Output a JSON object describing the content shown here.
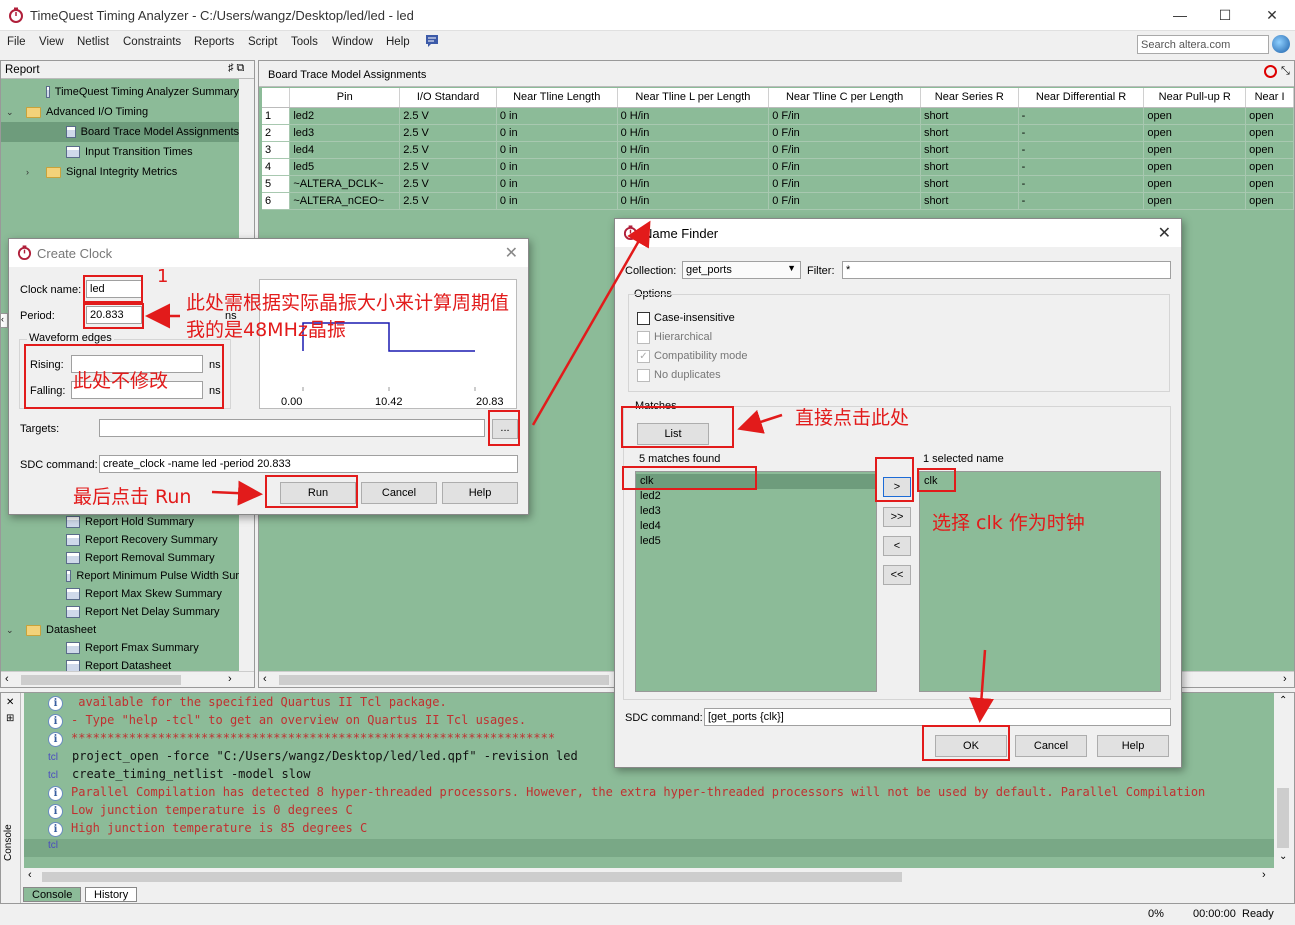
{
  "window": {
    "title": "TimeQuest Timing Analyzer - C:/Users/wangz/Desktop/led/led - led",
    "minimize": "—",
    "maximize": "☐",
    "close": "✕"
  },
  "menu": [
    "File",
    "View",
    "Netlist",
    "Constraints",
    "Reports",
    "Script",
    "Tools",
    "Window",
    "Help"
  ],
  "search": {
    "placeholder": "Search altera.com"
  },
  "report": {
    "label": "Report",
    "pin": "♯ ⧉",
    "items_top": [
      {
        "label": "TimeQuest Timing Analyzer Summary",
        "icon": "table-icon",
        "indent": 45,
        "arrow": ""
      },
      {
        "label": "Advanced I/O Timing",
        "icon": "folder-icon",
        "indent": 25,
        "arrow": "⌄"
      },
      {
        "label": "Board Trace Model Assignments",
        "icon": "table-icon",
        "indent": 65,
        "arrow": "",
        "selected": true
      },
      {
        "label": "Input Transition Times",
        "icon": "table-icon",
        "indent": 65,
        "arrow": ""
      },
      {
        "label": "Signal Integrity Metrics",
        "icon": "folder-icon",
        "indent": 45,
        "arrow": "›"
      }
    ],
    "items_bottom": [
      {
        "label": "Report Hold Summary",
        "icon": "report-icon",
        "indent": 65,
        "arrow": ""
      },
      {
        "label": "Report Recovery Summary",
        "icon": "report-icon",
        "indent": 65,
        "arrow": ""
      },
      {
        "label": "Report Removal Summary",
        "icon": "report-icon",
        "indent": 65,
        "arrow": ""
      },
      {
        "label": "Report Minimum Pulse Width Sur",
        "icon": "report-icon",
        "indent": 65,
        "arrow": ""
      },
      {
        "label": "Report Max Skew Summary",
        "icon": "report-icon",
        "indent": 65,
        "arrow": ""
      },
      {
        "label": "Report Net Delay Summary",
        "icon": "report-icon",
        "indent": 65,
        "arrow": ""
      },
      {
        "label": "Datasheet",
        "icon": "folder-icon",
        "indent": 25,
        "arrow": "⌄"
      },
      {
        "label": "Report Fmax Summary",
        "icon": "report-icon",
        "indent": 65,
        "arrow": ""
      },
      {
        "label": "Report Datasheet",
        "icon": "report-icon",
        "indent": 65,
        "arrow": ""
      }
    ]
  },
  "board": {
    "title": "Board Trace Model Assignments",
    "columns": [
      "",
      "Pin",
      "I/O Standard",
      "Near Tline Length",
      "Near Tline L per Length",
      "Near Tline C per Length",
      "Near Series R",
      "Near Differential R",
      "Near Pull-up R",
      "Near I"
    ],
    "rows": [
      [
        "1",
        "led2",
        "2.5 V",
        "0 in",
        "0 H/in",
        "0 F/in",
        "short",
        "-",
        "open",
        "open"
      ],
      [
        "2",
        "led3",
        "2.5 V",
        "0 in",
        "0 H/in",
        "0 F/in",
        "short",
        "-",
        "open",
        "open"
      ],
      [
        "3",
        "led4",
        "2.5 V",
        "0 in",
        "0 H/in",
        "0 F/in",
        "short",
        "-",
        "open",
        "open"
      ],
      [
        "4",
        "led5",
        "2.5 V",
        "0 in",
        "0 H/in",
        "0 F/in",
        "short",
        "-",
        "open",
        "open"
      ],
      [
        "5",
        "~ALTERA_DCLK~",
        "2.5 V",
        "0 in",
        "0 H/in",
        "0 F/in",
        "short",
        "-",
        "open",
        "open"
      ],
      [
        "6",
        "~ALTERA_nCEO~",
        "2.5 V",
        "0 in",
        "0 H/in",
        "0 F/in",
        "short",
        "-",
        "open",
        "open"
      ]
    ]
  },
  "console": {
    "lines": [
      {
        "type": "info",
        "text": "  available for the specified Quartus II Tcl package."
      },
      {
        "type": "info",
        "text": "- Type \"help -tcl\" to get an overview on Quartus II Tcl usages."
      },
      {
        "type": "info",
        "text": "*******************************************************************"
      },
      {
        "type": "tcl",
        "text": "project_open -force \"C:/Users/wangz/Desktop/led/led.qpf\" -revision led"
      },
      {
        "type": "tcl",
        "text": "create_timing_netlist -model slow"
      },
      {
        "type": "info",
        "text": "Parallel Compilation has detected 8 hyper-threaded processors. However, the extra hyper-threaded processors will not be used by default. Parallel Compilation"
      },
      {
        "type": "info",
        "text": "Low junction temperature is 0 degrees C"
      },
      {
        "type": "info",
        "text": "High junction temperature is 85 degrees C"
      }
    ],
    "prompt": "tcl",
    "side_label": "Console",
    "tabs": [
      "Console",
      "History"
    ]
  },
  "status": {
    "progress": "0%",
    "time": "00:00:00",
    "state": "Ready"
  },
  "create_clock": {
    "title": "Create Clock",
    "clock_name_label": "Clock name:",
    "clock_name": "led",
    "period_label": "Period:",
    "period": "20.833",
    "period_unit": "ns",
    "waveform_label": "Waveform edges",
    "rising_label": "Rising:",
    "falling_label": "Falling:",
    "ns": "ns",
    "targets_label": "Targets:",
    "browse": "...",
    "sdc_label": "SDC command:",
    "sdc": "create_clock -name led -period 20.833",
    "ticks": [
      "0.00",
      "10.42",
      "20.83"
    ],
    "run": "Run",
    "cancel": "Cancel",
    "help": "Help"
  },
  "name_finder": {
    "title": "Name Finder",
    "collection_label": "Collection:",
    "collection": "get_ports",
    "filter_label": "Filter:",
    "filter": "*",
    "options_label": "Options",
    "options": [
      {
        "label": "Case-insensitive",
        "checked": false,
        "disabled": false
      },
      {
        "label": "Hierarchical",
        "checked": false,
        "disabled": true
      },
      {
        "label": "Compatibility mode",
        "checked": true,
        "disabled": true
      },
      {
        "label": "No duplicates",
        "checked": false,
        "disabled": true
      }
    ],
    "matches_label": "Matches",
    "list": "List",
    "found": "5 matches found",
    "matches": [
      "clk",
      "led2",
      "led3",
      "led4",
      "led5"
    ],
    "selected_label": "1 selected name",
    "selected": [
      "clk"
    ],
    "move_one": ">",
    "move_all": ">>",
    "remove_one": "<",
    "remove_all": "<<",
    "sdc_label": "SDC command:",
    "sdc": "[get_ports {clk}]",
    "ok": "OK",
    "cancel": "Cancel",
    "help": "Help"
  },
  "annotations": {
    "num1": "1",
    "period_note": "此处需根据实际晶振大小来计算周期值",
    "crystal_note": "我的是48MHz晶振",
    "no_change": "此处不修改",
    "run_note": "最后点击 Run",
    "click_here": "直接点击此处",
    "select_clk": "选择 clk 作为时钟"
  }
}
